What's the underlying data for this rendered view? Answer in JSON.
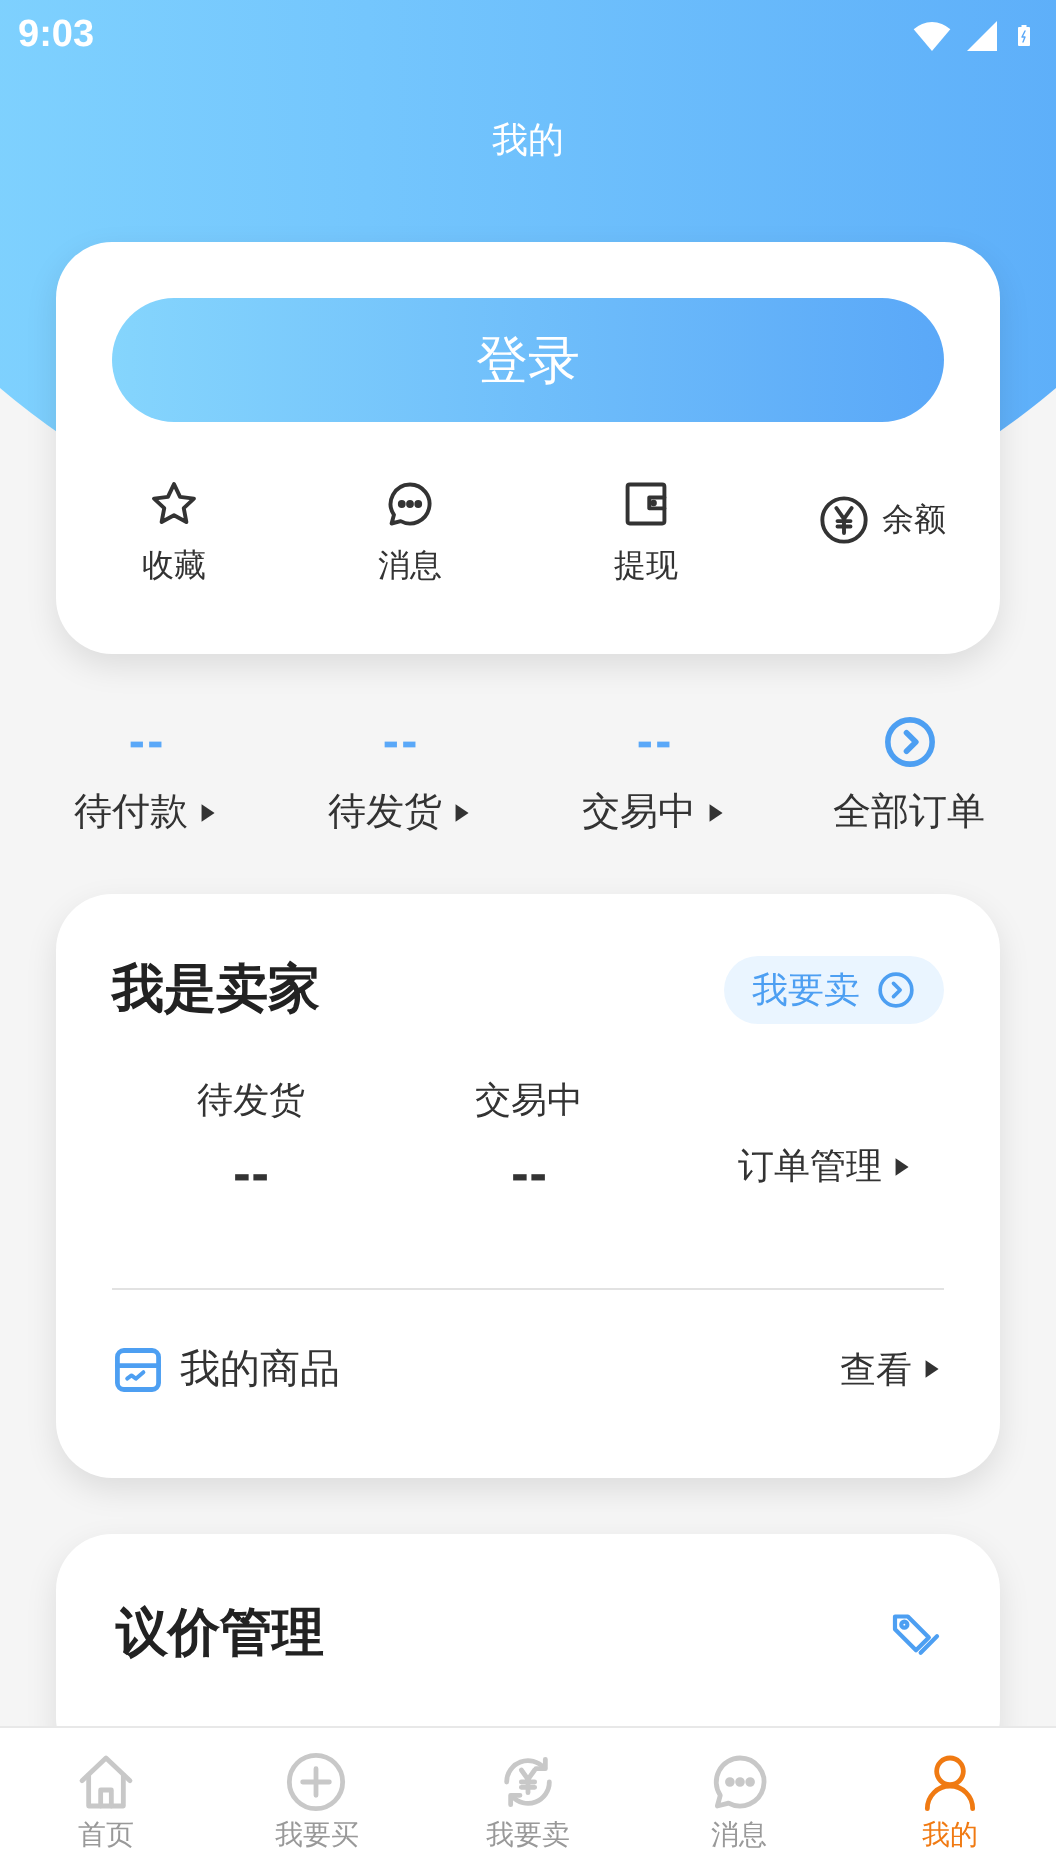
{
  "status_bar": {
    "time": "9:03"
  },
  "header": {
    "title": "我的"
  },
  "account_card": {
    "login_button": "登录",
    "shortcuts": [
      {
        "kind": "star",
        "label": "收藏"
      },
      {
        "kind": "chat",
        "label": "消息"
      },
      {
        "kind": "wallet",
        "label": "提现"
      },
      {
        "kind": "yuan",
        "label": "余额"
      }
    ]
  },
  "orders": [
    {
      "kind": "count",
      "value": "--",
      "label": "待付款"
    },
    {
      "kind": "count",
      "value": "--",
      "label": "待发货"
    },
    {
      "kind": "count",
      "value": "--",
      "label": "交易中"
    },
    {
      "kind": "link",
      "label": "全部订单"
    }
  ],
  "seller_card": {
    "title": "我是卖家",
    "sell_button": "我要卖",
    "stats": [
      {
        "label": "待发货",
        "value": "--"
      },
      {
        "label": "交易中",
        "value": "--"
      }
    ],
    "order_management": "订单管理",
    "my_goods": "我的商品",
    "view_link": "查看"
  },
  "bargain_card": {
    "title": "议价管理"
  },
  "tab_bar": [
    {
      "kind": "home",
      "label": "首页",
      "selected": false
    },
    {
      "kind": "plus",
      "label": "我要买",
      "selected": false
    },
    {
      "kind": "exchange",
      "label": "我要卖",
      "selected": false
    },
    {
      "kind": "chat",
      "label": "消息",
      "selected": false
    },
    {
      "kind": "person",
      "label": "我的",
      "selected": true
    }
  ]
}
